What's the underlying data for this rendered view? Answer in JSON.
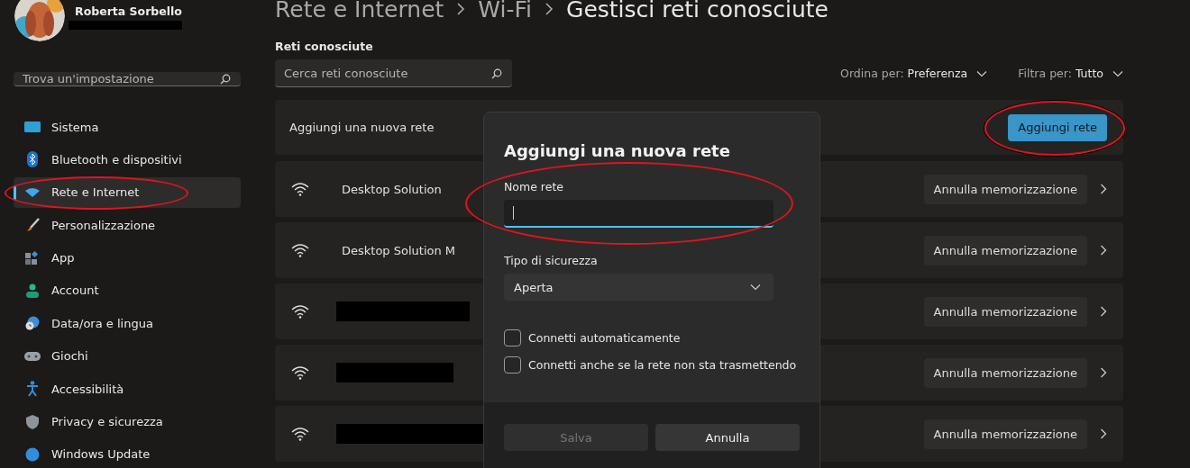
{
  "user": {
    "name": "Roberta Sorbello",
    "email_redacted": true
  },
  "sidebar": {
    "search": {
      "placeholder": "Trova un'impostazione"
    },
    "items": [
      {
        "label": "Sistema",
        "selected": false,
        "highlighted": false
      },
      {
        "label": "Bluetooth e dispositivi",
        "selected": false,
        "highlighted": false
      },
      {
        "label": "Rete e Internet",
        "selected": true,
        "highlighted": true
      },
      {
        "label": "Personalizzazione",
        "selected": false,
        "highlighted": false
      },
      {
        "label": "App",
        "selected": false,
        "highlighted": false
      },
      {
        "label": "Account",
        "selected": false,
        "highlighted": false
      },
      {
        "label": "Data/ora e lingua",
        "selected": false,
        "highlighted": false
      },
      {
        "label": "Giochi",
        "selected": false,
        "highlighted": false
      },
      {
        "label": "Accessibilità",
        "selected": false,
        "highlighted": false
      },
      {
        "label": "Privacy e sicurezza",
        "selected": false,
        "highlighted": false
      },
      {
        "label": "Windows Update",
        "selected": false,
        "highlighted": false
      }
    ]
  },
  "breadcrumb": [
    "Rete e Internet",
    "Wi-Fi",
    "Gestisci reti conosciute"
  ],
  "section_title": "Reti conosciute",
  "search": {
    "placeholder": "Cerca reti conosciute"
  },
  "sort": {
    "label": "Ordina per:",
    "value": "Preferenza"
  },
  "filter": {
    "label": "Filtra per:",
    "value": "Tutto"
  },
  "add_row": {
    "label": "Aggiungi una nuova rete",
    "button": "Aggiungi rete",
    "highlighted": true
  },
  "networks": [
    {
      "name": "Desktop Solution",
      "redacted": false,
      "button": "Annulla memorizzazione"
    },
    {
      "name": "Desktop Solution M",
      "redacted": false,
      "button": "Annulla memorizzazione"
    },
    {
      "redacted": true,
      "button": "Annulla memorizzazione"
    },
    {
      "redacted": true,
      "button": "Annulla memorizzazione"
    },
    {
      "redacted": true,
      "button": "Annulla memorizzazione"
    }
  ],
  "dialog": {
    "title": "Aggiungi una nuova rete",
    "name_field": {
      "label": "Nome rete",
      "focused": true,
      "highlighted": true
    },
    "security": {
      "label": "Tipo di sicurezza",
      "value": "Aperta"
    },
    "checkboxes": [
      {
        "label": "Connetti automaticamente",
        "checked": false
      },
      {
        "label": "Connetti anche se la rete non sta trasmettendo",
        "checked": false
      }
    ],
    "buttons": [
      {
        "label": "Salva",
        "disabled": true
      },
      {
        "label": "Annulla",
        "disabled": false
      }
    ]
  }
}
